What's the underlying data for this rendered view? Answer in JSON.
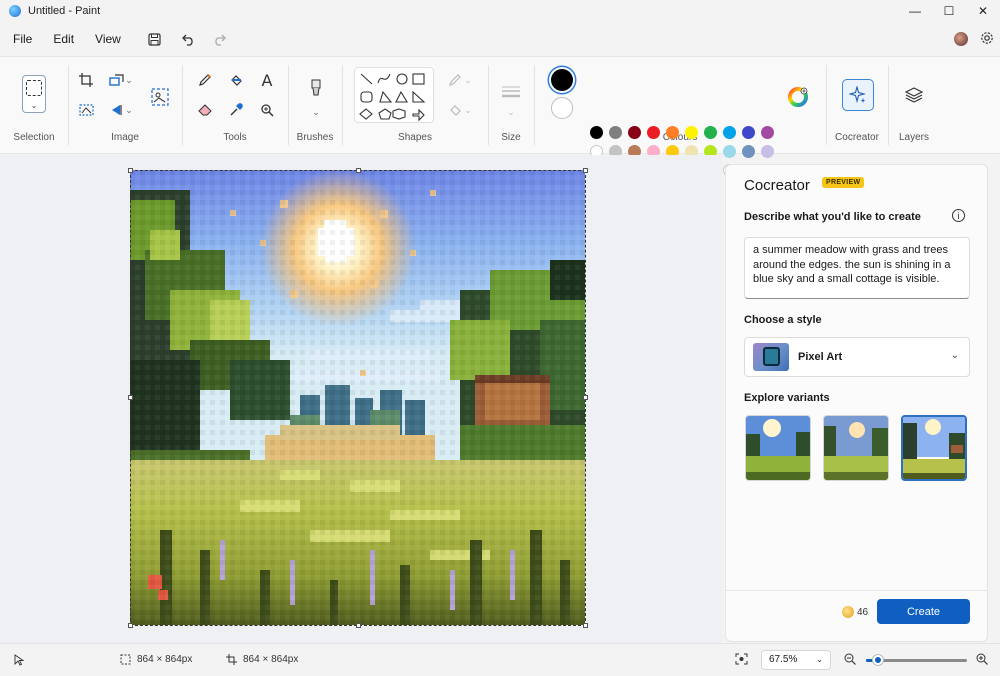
{
  "window": {
    "title": "Untitled - Paint",
    "minimize_glyph": "—",
    "maximize_glyph": "☐",
    "close_glyph": "✕"
  },
  "menu": {
    "items": [
      "File",
      "Edit",
      "View"
    ]
  },
  "ribbon": {
    "groups": {
      "selection": "Selection",
      "image": "Image",
      "tools": "Tools",
      "brushes": "Brushes",
      "shapes": "Shapes",
      "size": "Size",
      "colours": "Colours",
      "cocreator": "Cocreator",
      "layers": "Layers"
    },
    "text_tool_glyph": "A"
  },
  "palette": {
    "row1": [
      "#000000",
      "#7f7f7f",
      "#880015",
      "#ed1c24",
      "#ff7f27",
      "#fff200",
      "#22b14c",
      "#00a2e8",
      "#3f48cc",
      "#a349a4"
    ],
    "row2": [
      "#ffffff",
      "#c3c3c3",
      "#b97a57",
      "#ffaec9",
      "#ffc90e",
      "#efe4b0",
      "#b5e61d",
      "#99d9ea",
      "#7092be",
      "#c8bfe7"
    ],
    "row3_empty_count": 10,
    "primary": "#000000",
    "secondary": "#ffffff"
  },
  "cocreator": {
    "title": "Cocreator",
    "badge": "PREVIEW",
    "describe_label": "Describe what you'd like to create",
    "info_glyph": "i",
    "prompt": "a summer meadow with grass and trees around the edges. the sun is shining in a blue sky and a small cottage is visible.",
    "style_label": "Choose a style",
    "style_value": "Pixel Art",
    "explore_label": "Explore variants",
    "credits": "46",
    "create_label": "Create"
  },
  "status": {
    "selection_size": "864 × 864px",
    "canvas_size": "864 × 864px",
    "zoom": "67.5%",
    "zoom_slider_fraction": 0.12
  },
  "colors": {
    "accent": "#0f5fc0",
    "badge": "#f6c517"
  }
}
